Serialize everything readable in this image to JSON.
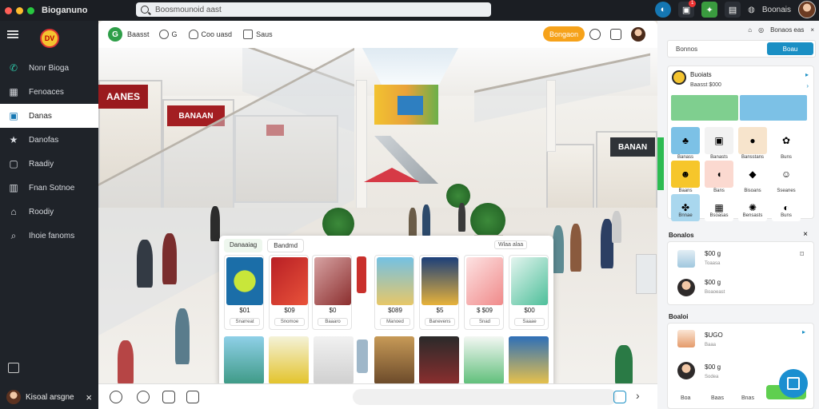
{
  "window": {
    "title": "Bioganuno",
    "url_text": "Boosmounoid aast",
    "chrome_icons": [
      "app-icon-blue",
      "notification-icon",
      "puzzle-icon",
      "file-icon"
    ],
    "notification_badge": "1",
    "profile_label": "Boonais"
  },
  "sidebar": {
    "logo_text": "DV",
    "items": [
      {
        "icon": "phone-icon",
        "label": "Nonr Bioga"
      },
      {
        "icon": "layers-icon",
        "label": "Fenoaces"
      },
      {
        "icon": "calendar-icon",
        "label": "Danas"
      },
      {
        "icon": "star-icon",
        "label": "Danofas"
      },
      {
        "icon": "document-icon",
        "label": "Raadiy"
      },
      {
        "icon": "grid-icon",
        "label": "Fnan Sotnoe"
      },
      {
        "icon": "map-icon",
        "label": "Roodiy"
      },
      {
        "icon": "search-icon",
        "label": "Ihoie fanoms"
      }
    ],
    "active_index": 2,
    "user_name": "Kisoal arsgne"
  },
  "main": {
    "top": {
      "brand": "Baasst",
      "items": [
        {
          "icon": "refresh-icon",
          "label": "G"
        },
        {
          "icon": "person-icon",
          "label": "Coo uasd"
        },
        {
          "icon": "mail-icon",
          "label": "Saus"
        }
      ],
      "orange_button": "Bongaon"
    },
    "scene": {
      "signs": [
        "AANES",
        "BANAAN",
        "BANAN"
      ]
    },
    "panel": {
      "tab_label": "Danaaiag",
      "tab2": "Bandmd",
      "chip": "Wlaa alaa",
      "cards_row1": [
        {
          "label": "$01",
          "button": "Snarreat"
        },
        {
          "label": "$09",
          "button": "Snomoe"
        },
        {
          "label": "$0",
          "button": "Baaaro"
        },
        {
          "label": "$089",
          "button": "Manoed"
        },
        {
          "label": "$5",
          "button": "Banevens"
        },
        {
          "label": "$ $09",
          "button": "Snad"
        },
        {
          "label": "$00",
          "button": "Saaae"
        }
      ]
    }
  },
  "right_panel": {
    "top_label": "Bonaos eas",
    "search_text": "Bonnos",
    "search_button": "Boau",
    "card1": {
      "title": "Buoiats",
      "subtitle": "Baasst $000",
      "tiles": [
        "Banass",
        "Banasts",
        "Bansstans",
        "Buns",
        "Baans",
        "Bans",
        "Bisoans",
        "Sseanes",
        "Bnnae",
        "Bsoasas",
        "Bensasts",
        "Buns"
      ]
    },
    "section1": {
      "title": "Bonalos",
      "rows": [
        {
          "value": "$00 g",
          "sub": "Toaasa"
        },
        {
          "value": "$00 g",
          "sub": "Boaoeast"
        }
      ]
    },
    "section2": {
      "title": "Boaloi",
      "rows": [
        {
          "value": "$UGO",
          "sub": "Baaa"
        },
        {
          "value": "$00 g",
          "sub": "Sodea"
        }
      ]
    },
    "bottom_tabs": [
      "Boa",
      "Baas",
      "Bnas"
    ]
  },
  "colors": {
    "accent_blue": "#1a8fc4",
    "accent_orange": "#f6a21a",
    "accent_green": "#2dbb52",
    "sidebar_bg": "#1f2329"
  }
}
